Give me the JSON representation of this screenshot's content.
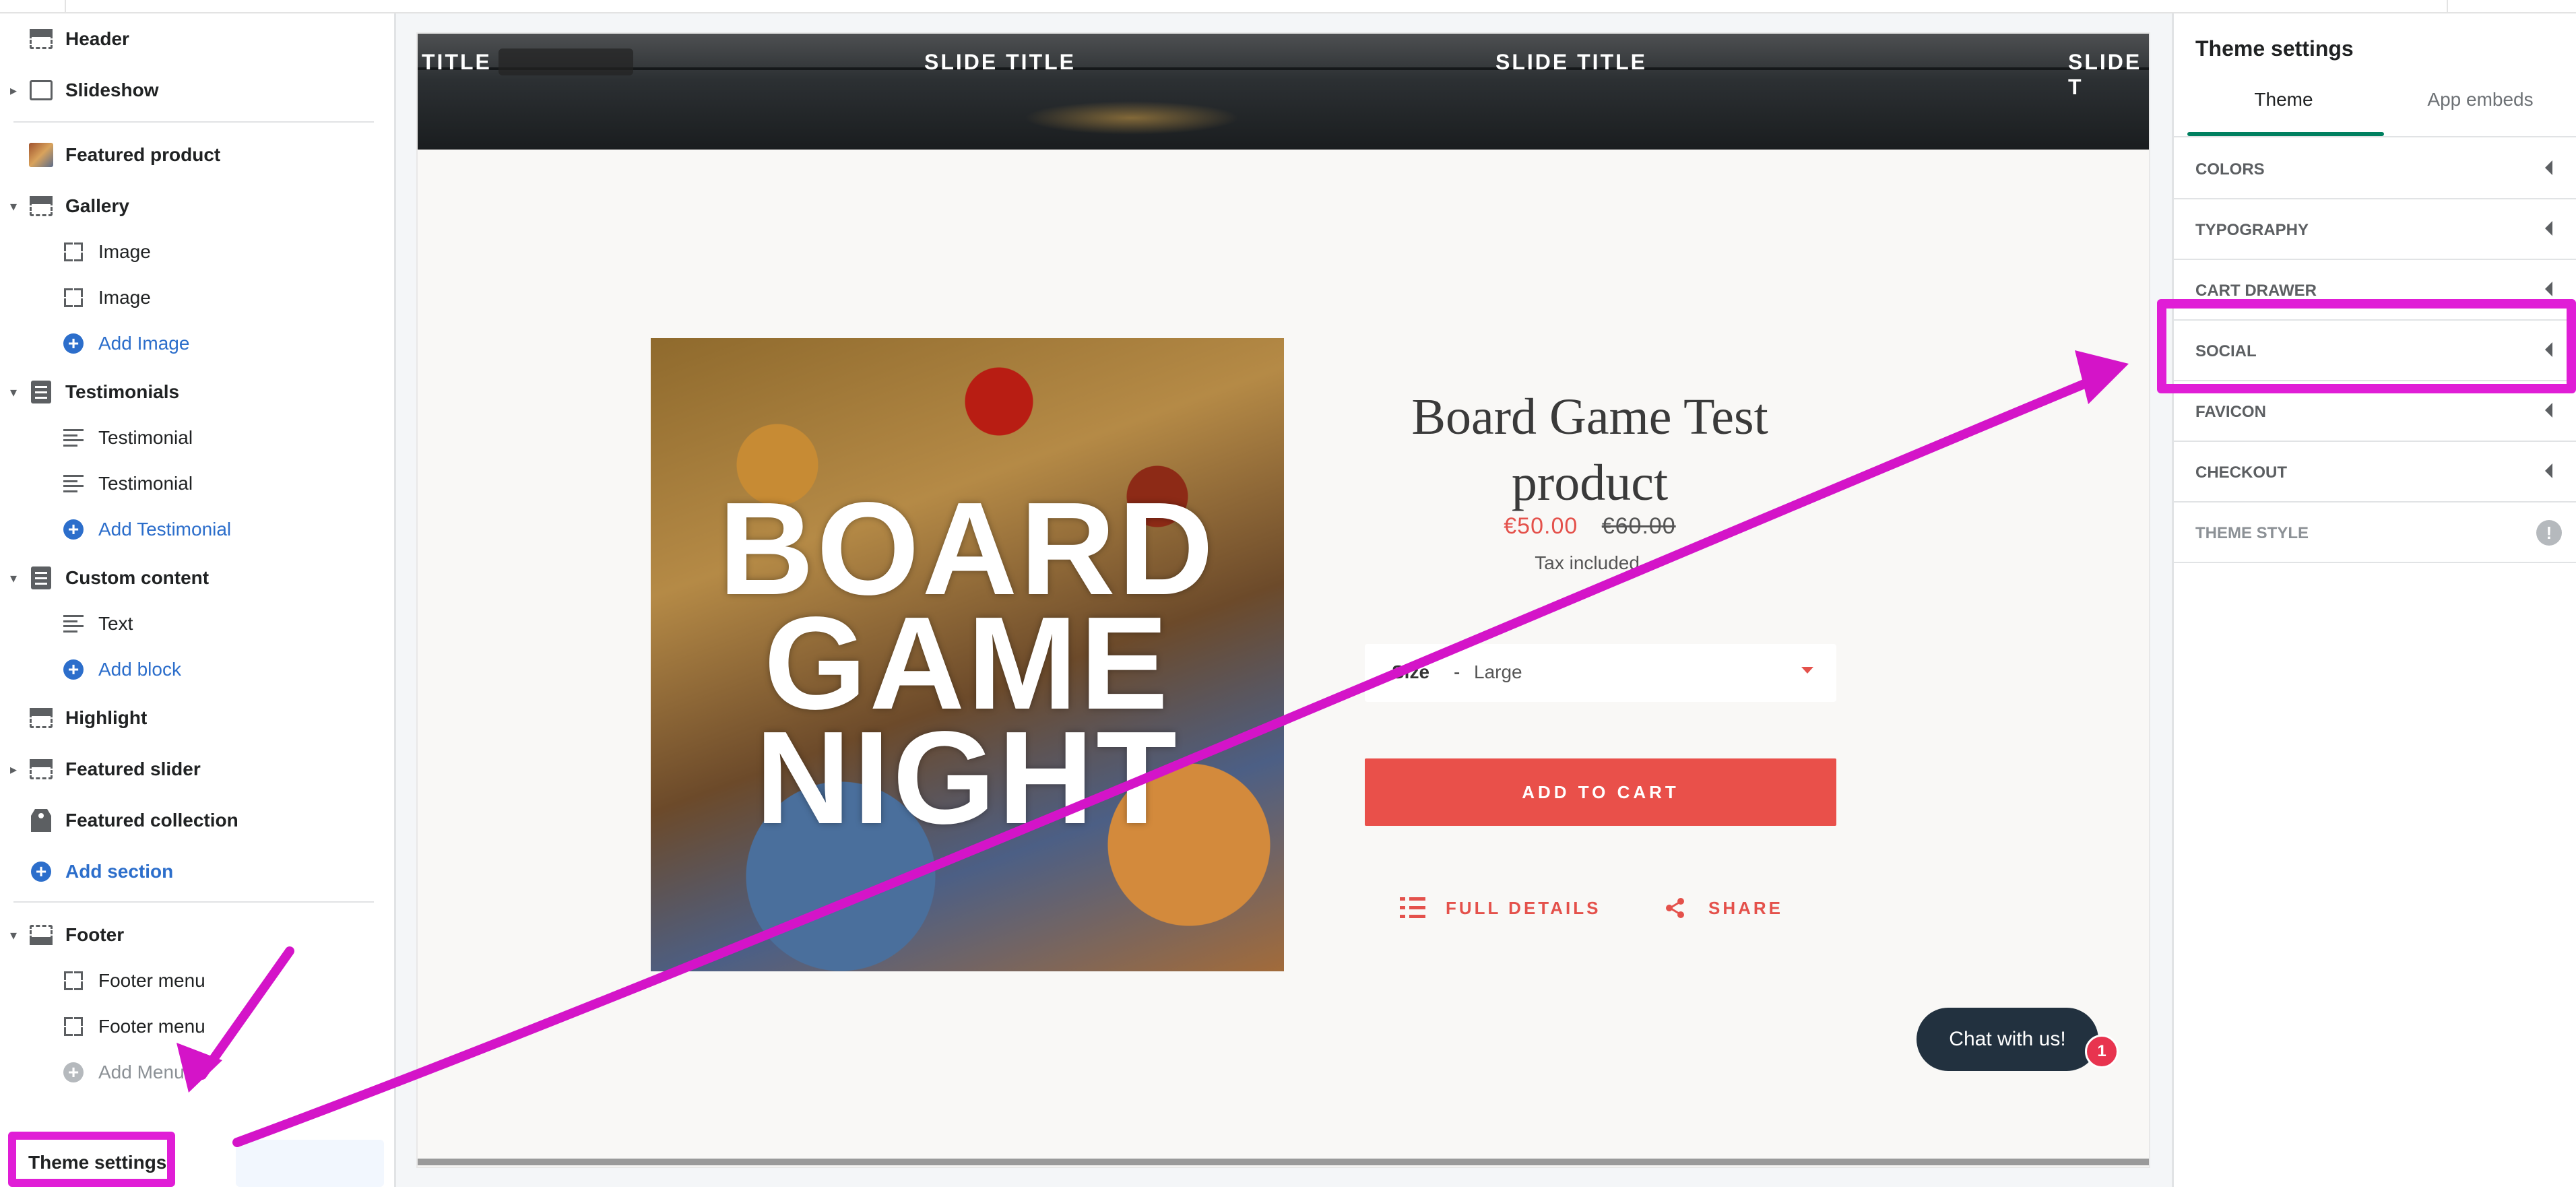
{
  "sidebar": {
    "sections": {
      "header": "Header",
      "slideshow": "Slideshow",
      "featured_product": "Featured product",
      "gallery": "Gallery",
      "gallery_block_1": "Image",
      "gallery_block_2": "Image",
      "gallery_add": "Add Image",
      "testimonials": "Testimonials",
      "testimonial_1": "Testimonial",
      "testimonial_2": "Testimonial",
      "testimonial_add": "Add Testimonial",
      "custom_content": "Custom content",
      "custom_text": "Text",
      "custom_add": "Add block",
      "highlight": "Highlight",
      "featured_slider": "Featured slider",
      "featured_collection": "Featured collection",
      "add_section": "Add section",
      "footer": "Footer",
      "footer_menu_1": "Footer menu",
      "footer_menu_2": "Footer menu",
      "footer_add": "Add Menu"
    },
    "theme_settings": "Theme settings"
  },
  "preview": {
    "slide_titles": [
      "TITLE",
      "SLIDE TITLE",
      "SLIDE TITLE",
      "SLIDE T"
    ],
    "product_image_words": [
      "BOARD",
      "GAME",
      "NIGHT"
    ],
    "product": {
      "title_line1": "Board Game Test",
      "title_line2": "product",
      "sale_price": "€50.00",
      "compare_price": "€60.00",
      "tax_note": "Tax included.",
      "variant_label": "Size",
      "variant_separator": "-",
      "variant_value": "Large",
      "add_to_cart": "ADD TO CART",
      "full_details": "FULL DETAILS",
      "share": "SHARE"
    },
    "chat": {
      "label": "Chat with us!",
      "badge": "1"
    }
  },
  "theme_panel": {
    "title": "Theme settings",
    "tabs": [
      "Theme",
      "App embeds"
    ],
    "accordion": [
      "COLORS",
      "TYPOGRAPHY",
      "CART DRAWER",
      "SOCIAL",
      "FAVICON",
      "CHECKOUT",
      "THEME STYLE"
    ],
    "theme_style_badge": "!"
  },
  "colors": {
    "accent_red": "#e9504a",
    "annotation_magenta": "#e01ed6",
    "editor_blue": "#2c6ecb",
    "tab_green": "#008060"
  }
}
